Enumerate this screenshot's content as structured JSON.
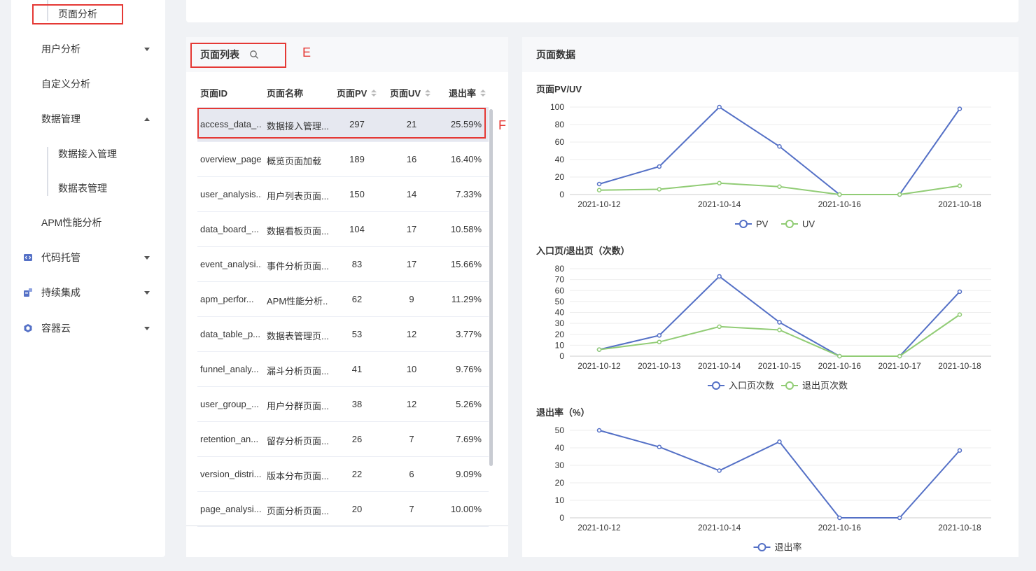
{
  "sidebar": {
    "items": [
      {
        "label": "页面分析"
      },
      {
        "label": "用户分析"
      },
      {
        "label": "自定义分析"
      },
      {
        "label": "数据管理"
      },
      {
        "label": "数据接入管理"
      },
      {
        "label": "数据表管理"
      },
      {
        "label": "APM性能分析"
      },
      {
        "label": "代码托管"
      },
      {
        "label": "持续集成"
      },
      {
        "label": "容器云"
      }
    ]
  },
  "annotations": {
    "e": "E",
    "f": "F"
  },
  "page_list": {
    "title": "页面列表",
    "columns": [
      "页面ID",
      "页面名称",
      "页面PV",
      "页面UV",
      "退出率"
    ],
    "rows": [
      {
        "id": "access_data_...",
        "name": "数据接入管理...",
        "pv": "297",
        "uv": "21",
        "rate": "25.59%"
      },
      {
        "id": "overview_page",
        "name": "概览页面加载",
        "pv": "189",
        "uv": "16",
        "rate": "16.40%"
      },
      {
        "id": "user_analysis...",
        "name": "用户列表页面...",
        "pv": "150",
        "uv": "14",
        "rate": "7.33%"
      },
      {
        "id": "data_board_...",
        "name": "数据看板页面...",
        "pv": "104",
        "uv": "17",
        "rate": "10.58%"
      },
      {
        "id": "event_analysi...",
        "name": "事件分析页面...",
        "pv": "83",
        "uv": "17",
        "rate": "15.66%"
      },
      {
        "id": "apm_perfor...",
        "name": "APM性能分析...",
        "pv": "62",
        "uv": "9",
        "rate": "11.29%"
      },
      {
        "id": "data_table_p...",
        "name": "数据表管理页...",
        "pv": "53",
        "uv": "12",
        "rate": "3.77%"
      },
      {
        "id": "funnel_analy...",
        "name": "漏斗分析页面...",
        "pv": "41",
        "uv": "10",
        "rate": "9.76%"
      },
      {
        "id": "user_group_...",
        "name": "用户分群页面...",
        "pv": "38",
        "uv": "12",
        "rate": "5.26%"
      },
      {
        "id": "retention_an...",
        "name": "留存分析页面...",
        "pv": "26",
        "uv": "7",
        "rate": "7.69%"
      },
      {
        "id": "version_distri...",
        "name": "版本分布页面...",
        "pv": "22",
        "uv": "6",
        "rate": "9.09%"
      },
      {
        "id": "page_analysi...",
        "name": "页面分析页面...",
        "pv": "20",
        "uv": "7",
        "rate": "10.00%"
      }
    ]
  },
  "page_data": {
    "title": "页面数据"
  },
  "colors": {
    "pv": "#5470c6",
    "uv": "#91cc75",
    "annotation": "#e53935"
  },
  "chart_data": [
    {
      "type": "line",
      "title": "页面PV/UV",
      "x": [
        "2021-10-12",
        "2021-10-13",
        "2021-10-14",
        "2021-10-15",
        "2021-10-16",
        "2021-10-17",
        "2021-10-18"
      ],
      "x_tick_labels": [
        "2021-10-12",
        "",
        "2021-10-14",
        "",
        "2021-10-16",
        "",
        "2021-10-18"
      ],
      "ylim": [
        0,
        100
      ],
      "yticks": [
        0,
        20,
        40,
        60,
        80,
        100
      ],
      "series": [
        {
          "name": "PV",
          "values": [
            12,
            32,
            100,
            55,
            0,
            0,
            98
          ]
        },
        {
          "name": "UV",
          "values": [
            5,
            6,
            13,
            9,
            0,
            0,
            10
          ]
        }
      ],
      "legend": "bottom-center",
      "grid": true
    },
    {
      "type": "line",
      "title": "入口页/退出页（次数）",
      "x": [
        "2021-10-12",
        "2021-10-13",
        "2021-10-14",
        "2021-10-15",
        "2021-10-16",
        "2021-10-17",
        "2021-10-18"
      ],
      "x_tick_labels": [
        "2021-10-12",
        "2021-10-13",
        "2021-10-14",
        "2021-10-15",
        "2021-10-16",
        "2021-10-17",
        "2021-10-18"
      ],
      "ylim": [
        0,
        80
      ],
      "yticks": [
        0,
        10,
        20,
        30,
        40,
        50,
        60,
        70,
        80
      ],
      "series": [
        {
          "name": "入口页次数",
          "values": [
            6,
            19,
            73,
            31,
            0,
            0,
            59
          ]
        },
        {
          "name": "退出页次数",
          "values": [
            6,
            13,
            27,
            24,
            0,
            0,
            38
          ]
        }
      ],
      "legend": "bottom-center",
      "grid": true
    },
    {
      "type": "line",
      "title": "退出率（%）",
      "x": [
        "2021-10-12",
        "2021-10-13",
        "2021-10-14",
        "2021-10-15",
        "2021-10-16",
        "2021-10-17",
        "2021-10-18"
      ],
      "x_tick_labels": [
        "2021-10-12",
        "",
        "2021-10-14",
        "",
        "2021-10-16",
        "",
        "2021-10-18"
      ],
      "ylim": [
        0,
        50
      ],
      "yticks": [
        0,
        10,
        20,
        30,
        40,
        50
      ],
      "series": [
        {
          "name": "退出率",
          "values": [
            50,
            40.5,
            27,
            43.5,
            0,
            0,
            38.5
          ]
        }
      ],
      "legend": "bottom-center",
      "grid": true
    }
  ]
}
